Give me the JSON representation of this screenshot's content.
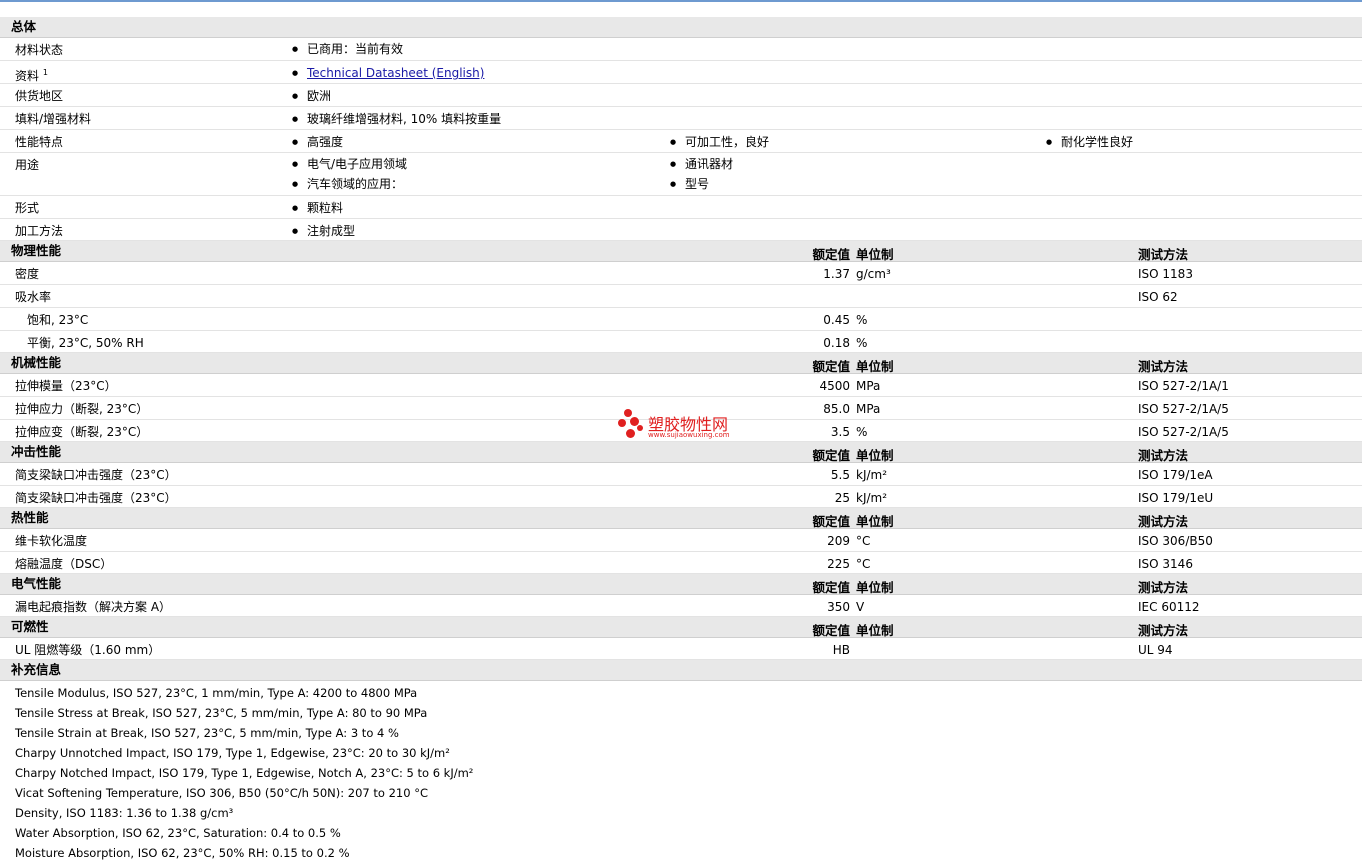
{
  "general": {
    "title": "总体",
    "rows": [
      {
        "label": "材料状态",
        "values": [
          "已商用：当前有效"
        ]
      },
      {
        "label": "资料",
        "sup": "1",
        "link": "Technical Datasheet (English)"
      },
      {
        "label": "供货地区",
        "values": [
          "欧洲"
        ]
      },
      {
        "label": "填料/增强材料",
        "values": [
          "玻璃纤维增强材料, 10% 填料按重量"
        ]
      },
      {
        "label": "性能特点",
        "values": [
          "高强度",
          "可加工性，良好",
          "耐化学性良好"
        ]
      },
      {
        "label": "用途",
        "values": [
          "电气/电子应用领域",
          "通讯器材",
          "汽车领域的应用：",
          "型号"
        ]
      },
      {
        "label": "形式",
        "values": [
          "颗粒料"
        ]
      },
      {
        "label": "加工方法",
        "values": [
          "注射成型"
        ]
      }
    ]
  },
  "headers": {
    "rated": "额定值",
    "unit": "单位制",
    "test": "测试方法"
  },
  "physical": {
    "title": "物理性能",
    "rows": [
      {
        "label": "密度",
        "value": "1.37",
        "unit": "g/cm³",
        "test": "ISO 1183"
      },
      {
        "label": "吸水率",
        "value": "",
        "unit": "",
        "test": "ISO 62"
      },
      {
        "label": "饱和, 23°C",
        "value": "0.45",
        "unit": "%",
        "test": ""
      },
      {
        "label": "平衡, 23°C, 50% RH",
        "value": "0.18",
        "unit": "%",
        "test": ""
      }
    ]
  },
  "mechanical": {
    "title": "机械性能",
    "rows": [
      {
        "label": "拉伸模量（23°C）",
        "value": "4500",
        "unit": "MPa",
        "test": "ISO 527-2/1A/1"
      },
      {
        "label": "拉伸应力（断裂, 23°C）",
        "value": "85.0",
        "unit": "MPa",
        "test": "ISO 527-2/1A/5"
      },
      {
        "label": "拉伸应变（断裂, 23°C）",
        "value": "3.5",
        "unit": "%",
        "test": "ISO 527-2/1A/5"
      }
    ]
  },
  "impact": {
    "title": "冲击性能",
    "rows": [
      {
        "label": "简支梁缺口冲击强度（23°C）",
        "value": "5.5",
        "unit": "kJ/m²",
        "test": "ISO 179/1eA"
      },
      {
        "label": "简支梁缺口冲击强度（23°C）",
        "value": "25",
        "unit": "kJ/m²",
        "test": "ISO 179/1eU"
      }
    ]
  },
  "thermal": {
    "title": "热性能",
    "rows": [
      {
        "label": "维卡软化温度",
        "value": "209",
        "unit": "°C",
        "test": "ISO 306/B50"
      },
      {
        "label": "熔融温度（DSC）",
        "value": "225",
        "unit": "°C",
        "test": "ISO 3146"
      }
    ]
  },
  "electrical": {
    "title": "电气性能",
    "rows": [
      {
        "label": "漏电起痕指数（解决方案 A）",
        "value": "350",
        "unit": "V",
        "test": "IEC 60112"
      }
    ]
  },
  "flammability": {
    "title": "可燃性",
    "rows": [
      {
        "label": "UL 阻燃等级（1.60 mm）",
        "value": "HB",
        "unit": "",
        "test": "UL 94"
      }
    ]
  },
  "supplementary": {
    "title": "补充信息",
    "lines": [
      "Tensile Modulus, ISO 527, 23°C, 1 mm/min, Type A: 4200 to 4800 MPa",
      "Tensile Stress at Break, ISO 527, 23°C, 5 mm/min, Type A: 80 to 90 MPa",
      "Tensile Strain at Break, ISO 527, 23°C, 5 mm/min, Type A: 3 to 4 %",
      "Charpy Unnotched Impact, ISO 179, Type 1, Edgewise, 23°C: 20 to 30 kJ/m²",
      "Charpy Notched Impact, ISO 179, Type 1, Edgewise, Notch A, 23°C: 5 to 6 kJ/m²",
      "Vicat Softening Temperature, ISO 306, B50 (50°C/h 50N): 207 to 210 °C",
      "Density, ISO 1183: 1.36 to 1.38 g/cm³",
      "Water Absorption, ISO 62, 23°C, Saturation: 0.4 to 0.5 %",
      "Moisture Absorption, ISO 62, 23°C, 50% RH: 0.15 to 0.2 %"
    ]
  },
  "watermark": {
    "title": "塑胶物性网",
    "url": "www.sujiaowuxing.com",
    "color": "#e02020"
  }
}
